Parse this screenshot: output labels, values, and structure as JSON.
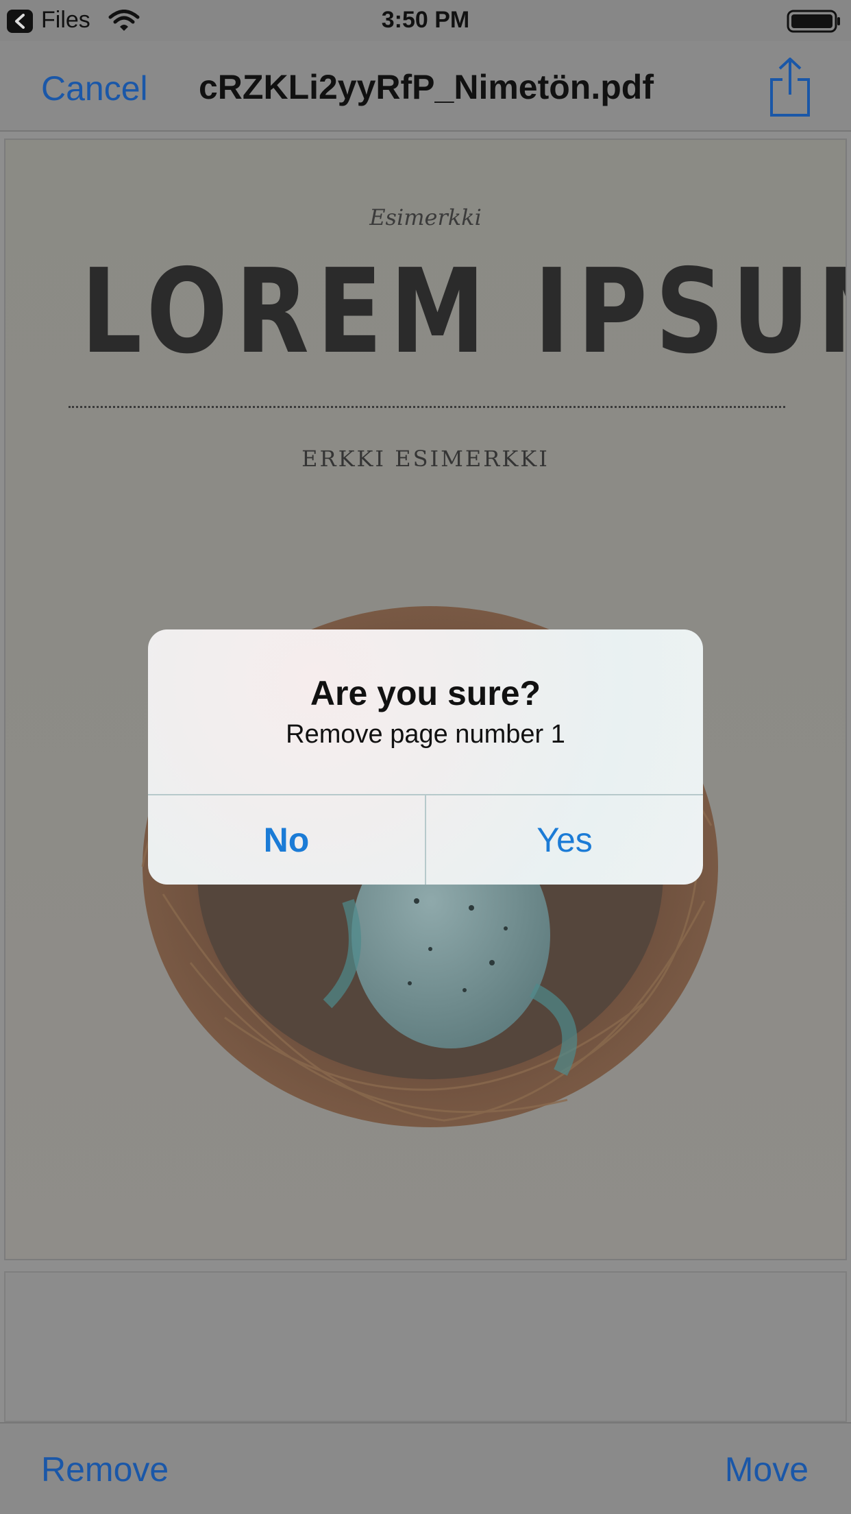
{
  "status_bar": {
    "back_app": "Files",
    "time": "3:50 PM"
  },
  "nav": {
    "cancel": "Cancel",
    "title": "cRZKLi2yyRfP_Nimetön.pdf"
  },
  "document": {
    "kicker": "Esimerkki",
    "heading": "LOREM IPSUM",
    "author": "ERKKI ESIMERKKI"
  },
  "alert": {
    "title": "Are you sure?",
    "message": "Remove page number 1",
    "no": "No",
    "yes": "Yes"
  },
  "toolbar": {
    "remove": "Remove",
    "move": "Move"
  },
  "colors": {
    "accent": "#1b7bd6",
    "dimmed_accent": "#1a57a8"
  }
}
